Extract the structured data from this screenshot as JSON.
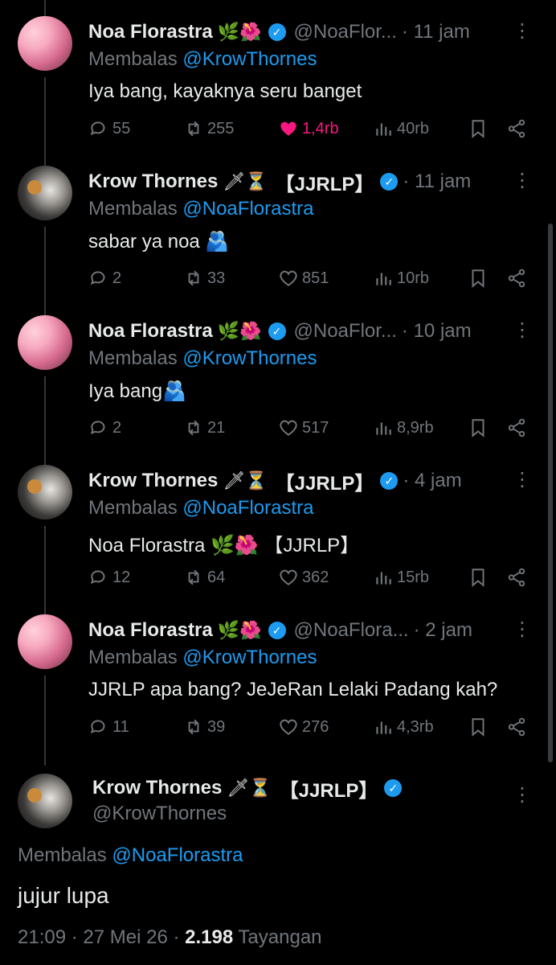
{
  "tweets": [
    {
      "name": "Noa Florastra",
      "emoji": "🌿🌺",
      "handle": "@NoaFlor...",
      "time": "· 11 jam",
      "reply_prefix": "Membalas",
      "reply_to": "@KrowThornes",
      "text": "Iya bang, kayaknya seru banget",
      "replies": "55",
      "reposts": "255",
      "likes": "1,4rb",
      "views": "40rb",
      "liked": true
    },
    {
      "name": "Krow Thornes",
      "emoji": "🗡⏳",
      "tag": "【JJRLP】",
      "time": "· 11 jam",
      "reply_prefix": "Membalas",
      "reply_to": "@NoaFlorastra",
      "text": "sabar ya noa 🫂",
      "replies": "2",
      "reposts": "33",
      "likes": "851",
      "views": "10rb",
      "liked": false
    },
    {
      "name": "Noa Florastra",
      "emoji": "🌿🌺",
      "handle": "@NoaFlor...",
      "time": "· 10 jam",
      "reply_prefix": "Membalas",
      "reply_to": "@KrowThornes",
      "text": "Iya bang🫂",
      "replies": "2",
      "reposts": "21",
      "likes": "517",
      "views": "8,9rb",
      "liked": false
    },
    {
      "name": "Krow Thornes",
      "emoji": "🗡⏳",
      "tag": "【JJRLP】",
      "time": "· 4 jam",
      "reply_prefix": "Membalas",
      "reply_to": "@NoaFlorastra",
      "text": "Noa Florastra 🌿🌺 【JJRLP】",
      "replies": "12",
      "reposts": "64",
      "likes": "362",
      "views": "15rb",
      "liked": false
    },
    {
      "name": "Noa Florastra",
      "emoji": "🌿🌺",
      "handle": "@NoaFlora...",
      "time": "· 2 jam",
      "reply_prefix": "Membalas",
      "reply_to": "@KrowThornes",
      "text": "JJRLP apa bang? JeJeRan Lelaki Padang kah?",
      "replies": "11",
      "reposts": "39",
      "likes": "276",
      "views": "4,3rb",
      "liked": false
    }
  ],
  "main": {
    "name": "Krow Thornes",
    "emoji": "🗡⏳",
    "tag": "【JJRLP】",
    "handle": "@KrowThornes",
    "reply_prefix": "Membalas",
    "reply_to": "@NoaFlorastra",
    "text": "jujur lupa",
    "time": "21:09",
    "date": "27 Mei 26",
    "views_count": "2.198",
    "views_label": "Tayangan"
  },
  "colors": {
    "accent": "#1d9bf0",
    "like": "#f91880",
    "muted": "#71767b",
    "background": "#000000"
  }
}
